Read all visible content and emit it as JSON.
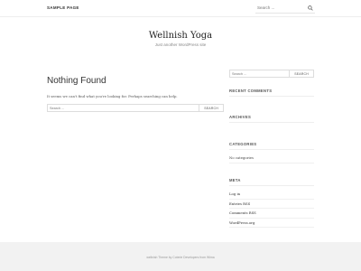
{
  "header": {
    "nav": [
      {
        "label": "SAMPLE PAGE"
      }
    ],
    "search": {
      "placeholder": "Search ..."
    }
  },
  "site": {
    "title": "Wellnish Yoga",
    "description": "Just another WordPress site"
  },
  "main": {
    "title": "Nothing Found",
    "message": "It seems we can't find what you're looking for. Perhaps searching can help.",
    "search": {
      "placeholder": "Search ...",
      "button": "SEARCH"
    }
  },
  "sidebar": {
    "search": {
      "placeholder": "Search ...",
      "button": "SEARCH"
    },
    "widgets": [
      {
        "title": "RECENT COMMENTS",
        "items": []
      },
      {
        "title": "ARCHIVES",
        "items": []
      },
      {
        "title": "CATEGORIES",
        "items": [
          "No categories"
        ]
      },
      {
        "title": "META",
        "items": [
          "Log in",
          "Entries RSS",
          "Comments RSS",
          "WordPress.org"
        ]
      }
    ]
  },
  "footer": {
    "text": "wellnish Theme by Coterie Developers from Wima"
  },
  "colors": {
    "footer_bg": "#f2f2f2",
    "text": "#444444",
    "border": "#dddddd"
  }
}
